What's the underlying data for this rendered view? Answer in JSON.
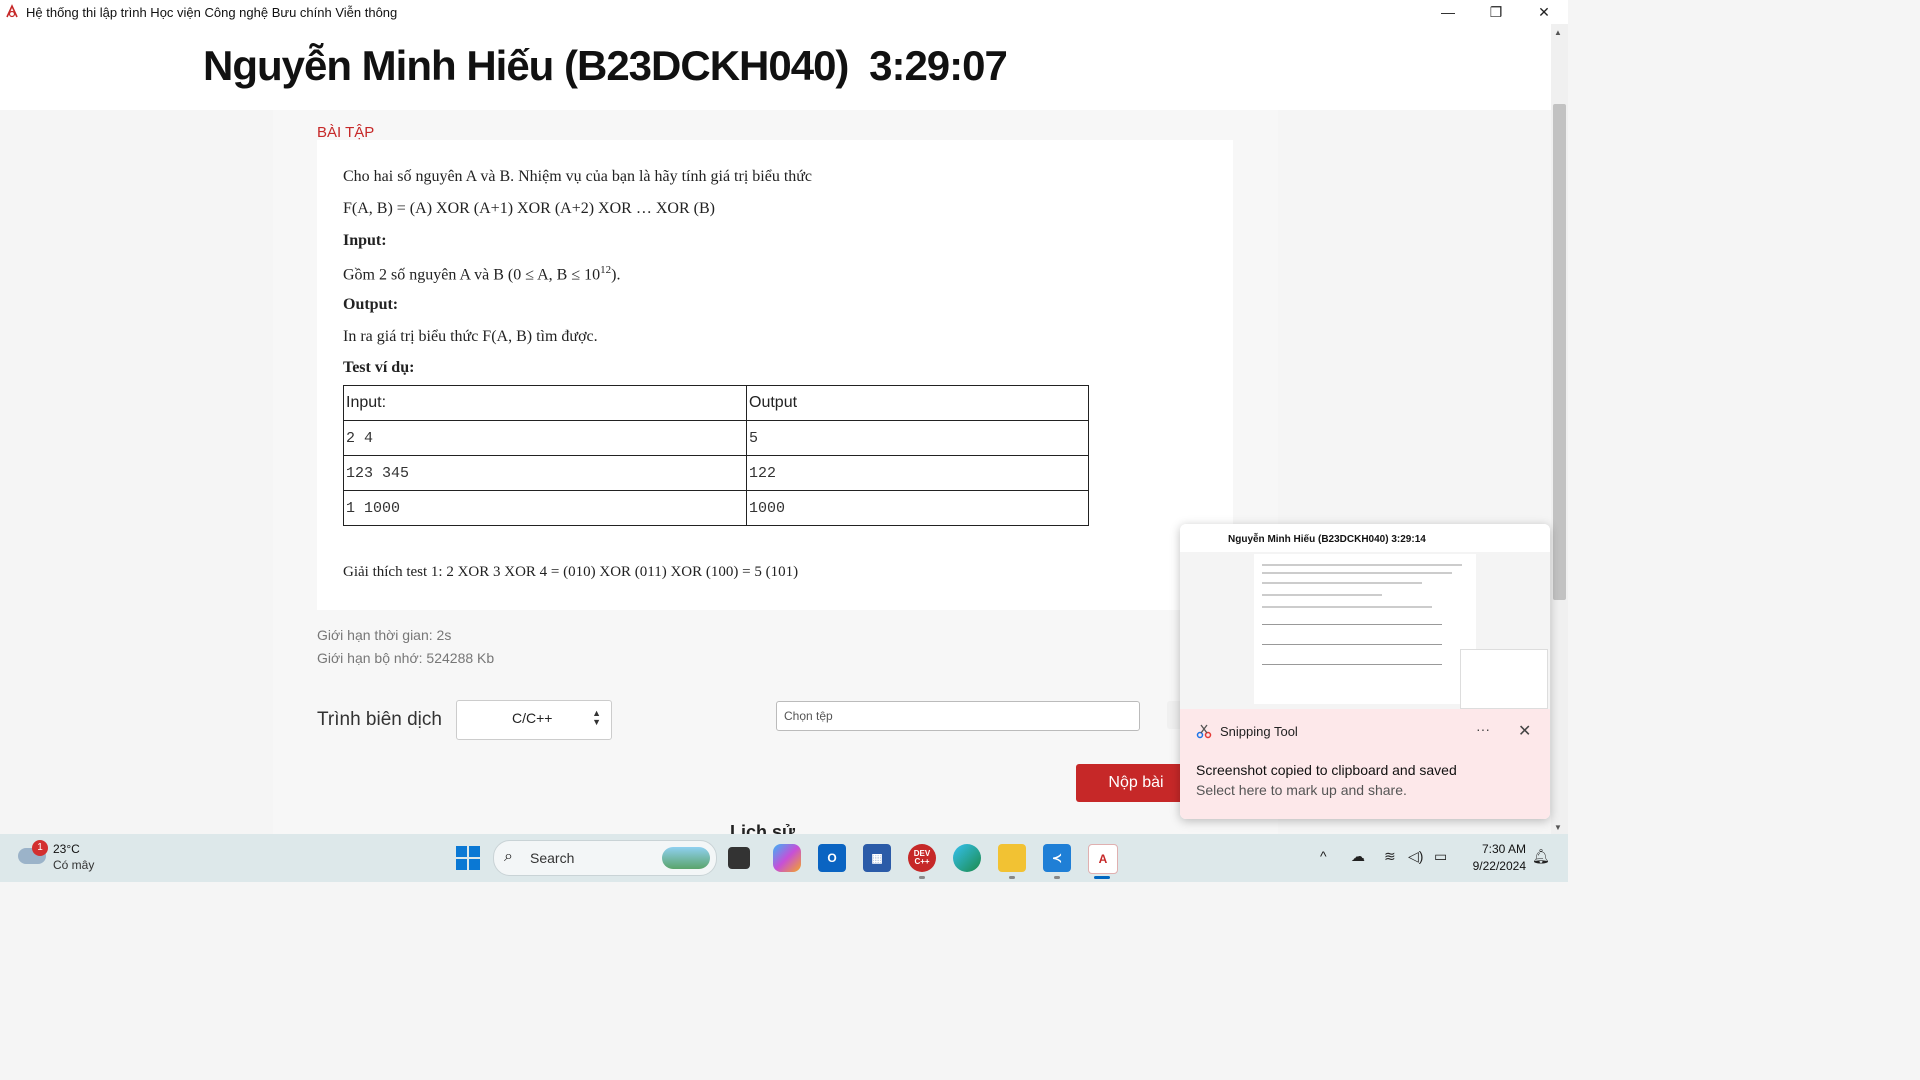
{
  "window": {
    "title": "Hệ thống thi lập trình Học viện Công nghệ Bưu chính Viễn thông",
    "minimize": "—",
    "restore": "❐",
    "close": "✕"
  },
  "header": {
    "student": "Nguyễn Minh Hiếu (B23DCKH040)",
    "timer": "3:29:07"
  },
  "exercise": {
    "section_label": "BÀI TẬP",
    "statement": "Cho hai số nguyên A và B. Nhiệm vụ của bạn là hãy tính giá trị biểu thức",
    "formula": "F(A, B) = (A) XOR (A+1) XOR (A+2) XOR … XOR (B)",
    "input_heading": "Input:",
    "input_text": "Gồm 2 số nguyên A và B (0 ≤ A, B ≤ 10",
    "input_exp": "12",
    "input_end": ").",
    "output_heading": "Output:",
    "output_text": "In ra giá trị biểu thức F(A, B) tìm được.",
    "examples_heading": "Test ví dụ:",
    "table": {
      "headers": [
        "Input:",
        "Output"
      ],
      "rows": [
        [
          "2 4",
          "5"
        ],
        [
          "123 345",
          "122"
        ],
        [
          "1 1000",
          "1000"
        ]
      ]
    },
    "explanation": "Giải thích test 1: 2 XOR 3 XOR 4 = (010) XOR (011) XOR (100) = 5 (101)"
  },
  "limits": {
    "time": "Giới hạn thời gian: 2s",
    "memory": "Giới hạn bộ nhớ: 524288 Kb"
  },
  "submit_form": {
    "compiler_label": "Trình biên dịch",
    "compiler_value": "C/C++",
    "file_placeholder": "Chọn tệp",
    "submit_label": "Nộp bài",
    "bottom_heading": "Lịch sử"
  },
  "snipping": {
    "app": "Snipping Tool",
    "message": "Screenshot copied to clipboard and saved",
    "sub": "Select here to mark up and share.",
    "thumb_title": "Nguyễn Minh Hiếu (B23DCKH040) 3:29:14",
    "more": "···",
    "close": "✕"
  },
  "taskbar": {
    "weather_badge": "1",
    "temperature": "23°C",
    "condition": "Có mây",
    "search_label": "Search",
    "time": "7:30 AM",
    "date": "9/22/2024",
    "devcpp": "DEV C++"
  },
  "colors": {
    "accent_red": "#c62828",
    "taskbar_bg": "#dde8ea",
    "notification_bg": "#fde8ea"
  }
}
